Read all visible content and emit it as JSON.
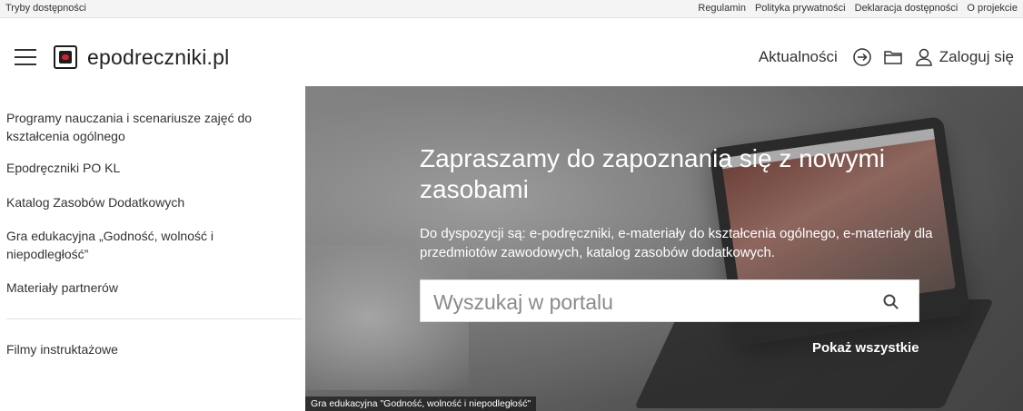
{
  "topbar": {
    "accessibility": "Tryby dostępności",
    "links": [
      "Regulamin",
      "Polityka prywatności",
      "Deklaracja dostępności",
      "O projekcie"
    ]
  },
  "header": {
    "logo_text": "epodreczniki.pl",
    "news": "Aktualności",
    "login": "Zaloguj się",
    "icons": [
      "menu-icon",
      "book-logo-icon",
      "sign-in-icon",
      "folder-icon",
      "user-icon"
    ]
  },
  "sidebar": {
    "items": [
      "Programy nauczania i scenariusze zajęć do kształcenia ogólnego",
      "Epodręczniki PO KL",
      "Katalog Zasobów Dodatkowych",
      "Gra edukacyjna „Godność, wolność i niepodległość”",
      "Materiały partnerów"
    ],
    "bottom_item": "Filmy instruktażowe"
  },
  "hero": {
    "title": "Zapraszamy do zapoznania się z nowymi zasobami",
    "subtitle": "Do dyspozycji są: e-podręczniki, e-materiały do kształcenia ogólnego, e-materiały dla przedmiotów zawodowych, katalog zasobów dodatkowych.",
    "search_placeholder": "Wyszukaj w portalu",
    "show_all": "Pokaż wszystkie",
    "caption": "Gra edukacyjna \"Godność, wolność i niepodległość\""
  },
  "colors": {
    "logo_accent": "#d4232a",
    "text": "#333333"
  }
}
